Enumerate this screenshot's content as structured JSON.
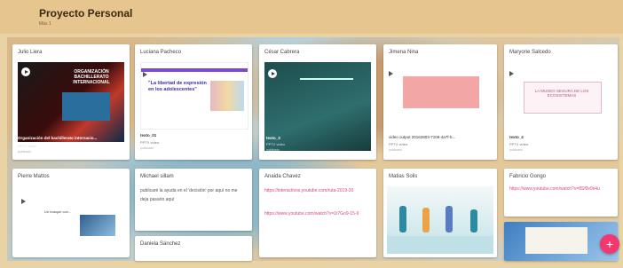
{
  "header": {
    "title": "Proyecto Personal",
    "subtitle": "Más 1"
  },
  "cards": [
    {
      "author": "Julio Liera",
      "caption": "Organización del bachillerato internacio...",
      "meta": "PPTX video",
      "by": "publicado",
      "slide_text": "ORGANIZACIÓN BACHILLERATO INTERNACIONAL"
    },
    {
      "author": "Luciana Pacheco",
      "caption": "texto_01",
      "meta": "PPTX video",
      "by": "publicado",
      "slide_text": "\"La libertad de expresión en los adolescentes\""
    },
    {
      "author": "César Cabrera",
      "caption": "texto_3",
      "meta": "PPTX video",
      "by": "publicado"
    },
    {
      "author": "Jimena Nina",
      "caption": "video output 20162803-7109-4a7f-b...",
      "meta": "PPTX video",
      "by": "publicado"
    },
    {
      "author": "Maryorie Salcedo",
      "caption": "texto_4",
      "meta": "PPTX video",
      "by": "publicado",
      "slide_text": "LA MUSEO SEGURA DE LOS ECOSISTEMAS"
    },
    {
      "author": "Pierre Mattos",
      "slide_text": "Un bosque con...",
      "caption": ""
    },
    {
      "author": "Michael sillam",
      "body": "publicaré la ayuda en el 'decisión' por aquí no me deja pasarlo aquí"
    },
    {
      "author": "Anaida Chavez",
      "link1": "https://interactivos.youtube.com/ruta-2019-20",
      "link2": "https://www.youtube.com/watch?v=1t7Gn9-15-9"
    },
    {
      "author": "Matias Solis"
    },
    {
      "author": "Fabricio Gongo",
      "link1": "https://www.youtube.com/watch?v=8Sf9v9s4u"
    },
    {
      "author": "Daniela Sánchez"
    }
  ],
  "fab": {
    "label": "+"
  },
  "colors": {
    "header": "#e6c58e",
    "link": "#e0457b",
    "fab": "#f2386f"
  }
}
